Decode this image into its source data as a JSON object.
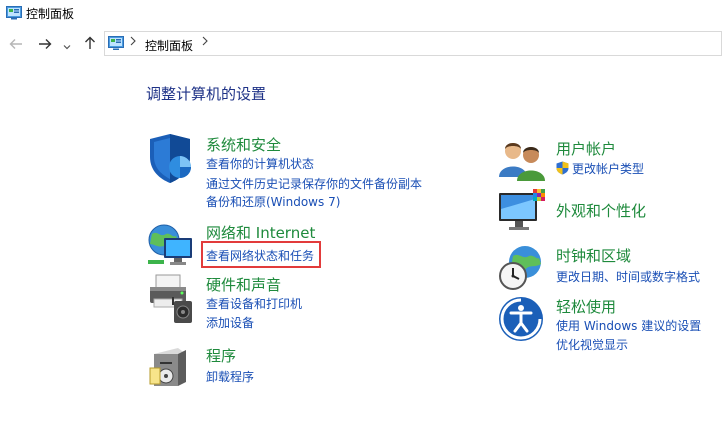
{
  "window": {
    "title": "控制面板"
  },
  "address": {
    "breadcrumb": "控制面板"
  },
  "heading": "调整计算机的设置",
  "left": [
    {
      "title": "系统和安全",
      "links": [
        "查看你的计算机状态",
        "通过文件历史记录保存你的文件备份副本",
        "备份和还原(Windows 7)"
      ]
    },
    {
      "title": "网络和 Internet",
      "links": [
        "查看网络状态和任务"
      ]
    },
    {
      "title": "硬件和声音",
      "links": [
        "查看设备和打印机",
        "添加设备"
      ]
    },
    {
      "title": "程序",
      "links": [
        "卸载程序"
      ]
    }
  ],
  "right": [
    {
      "title": "用户帐户",
      "links": [
        "更改帐户类型"
      ]
    },
    {
      "title": "外观和个性化",
      "links": []
    },
    {
      "title": "时钟和区域",
      "links": [
        "更改日期、时间或数字格式"
      ]
    },
    {
      "title": "轻松使用",
      "links": [
        "使用 Windows 建议的设置",
        "优化视觉显示"
      ]
    }
  ],
  "colors": {
    "category_title": "#1e8a3c",
    "link": "#1a4fb5",
    "heading": "#1e3287",
    "highlight_border": "#e23b3b"
  }
}
